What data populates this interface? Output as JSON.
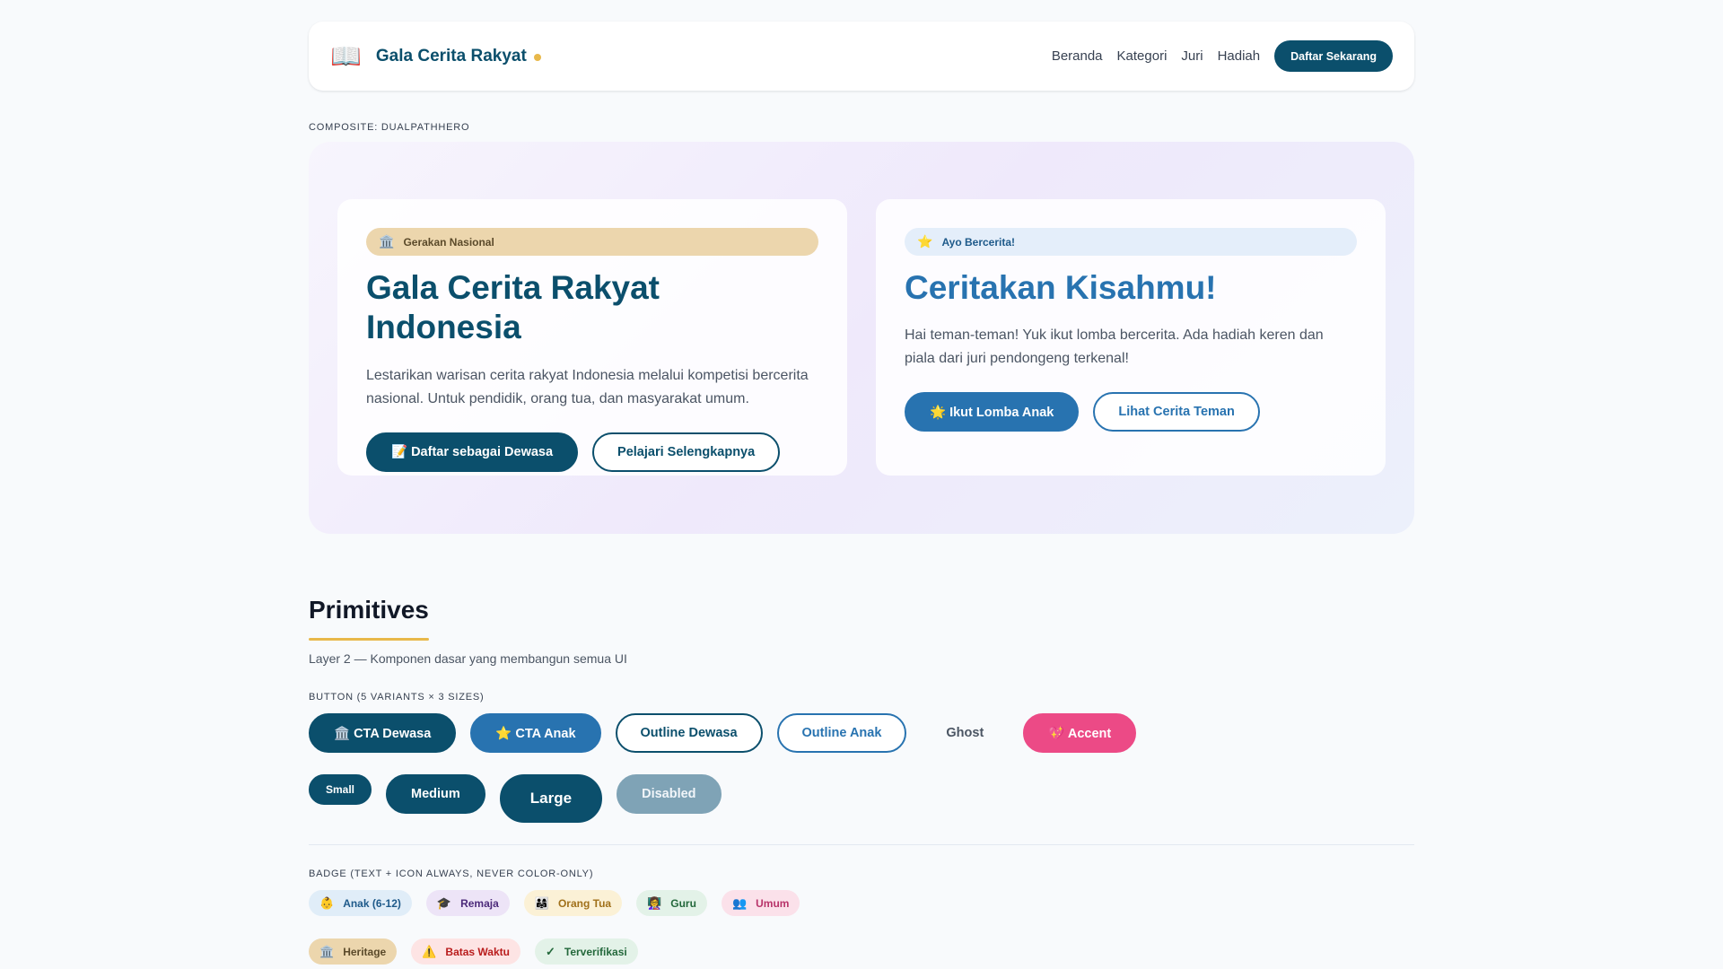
{
  "nav": {
    "brand_icon": "📖",
    "brand_name": "Gala Cerita Rakyat",
    "links": [
      "Beranda",
      "Kategori",
      "Juri",
      "Hadiah"
    ],
    "cta": "Daftar Sekarang"
  },
  "hero": {
    "composite_label": "COMPOSITE: DUALPATHHERO",
    "left": {
      "pill_icon": "🏛️",
      "pill": "Gerakan Nasional",
      "title": "Gala Cerita Rakyat Indonesia",
      "text": "Lestarikan warisan cerita rakyat Indonesia melalui kompetisi bercerita nasional. Untuk pendidik, orang tua, dan masyarakat umum.",
      "primary": "📝 Daftar sebagai Dewasa",
      "secondary": "Pelajari Selengkapnya"
    },
    "right": {
      "pill_icon": "⭐",
      "pill": "Ayo Bercerita!",
      "title": "Ceritakan Kisahmu!",
      "text": "Hai teman-teman! Yuk ikut lomba bercerita. Ada hadiah keren dan piala dari juri pendongeng terkenal!",
      "primary": "🌟 Ikut Lomba Anak",
      "secondary": "Lihat Cerita Teman"
    }
  },
  "primitives": {
    "title": "Primitives",
    "subtitle": "Layer 2 — Komponen dasar yang membangun semua UI",
    "button_label": "BUTTON (5 VARIANTS × 3 SIZES)",
    "variants": {
      "cta_dewasa": "🏛️ CTA Dewasa",
      "cta_anak": "⭐ CTA Anak",
      "outline_dewasa": "Outline Dewasa",
      "outline_anak": "Outline Anak",
      "ghost": "Ghost",
      "accent": "💖 Accent"
    },
    "sizes": {
      "small": "Small",
      "medium": "Medium",
      "large": "Large",
      "disabled": "Disabled"
    },
    "badge_label": "BADGE (TEXT + ICON ALWAYS, NEVER COLOR-ONLY)",
    "badges_row1": [
      {
        "icon": "👶",
        "label": "Anak (6-12)"
      },
      {
        "icon": "🎓",
        "label": "Remaja"
      },
      {
        "icon": "👨‍👩‍👧",
        "label": "Orang Tua"
      },
      {
        "icon": "👩‍🏫",
        "label": "Guru"
      },
      {
        "icon": "👥",
        "label": "Umum"
      }
    ],
    "badges_row2": [
      {
        "icon": "🏛️",
        "label": "Heritage"
      },
      {
        "icon": "⚠️",
        "label": "Batas Waktu"
      },
      {
        "icon": "✓",
        "label": "Terverifikasi"
      }
    ]
  },
  "colors": {
    "navy": "#0b4f6c",
    "blue": "#2873b0",
    "gold": "#e8b84a",
    "accent": "#ec4a86"
  }
}
